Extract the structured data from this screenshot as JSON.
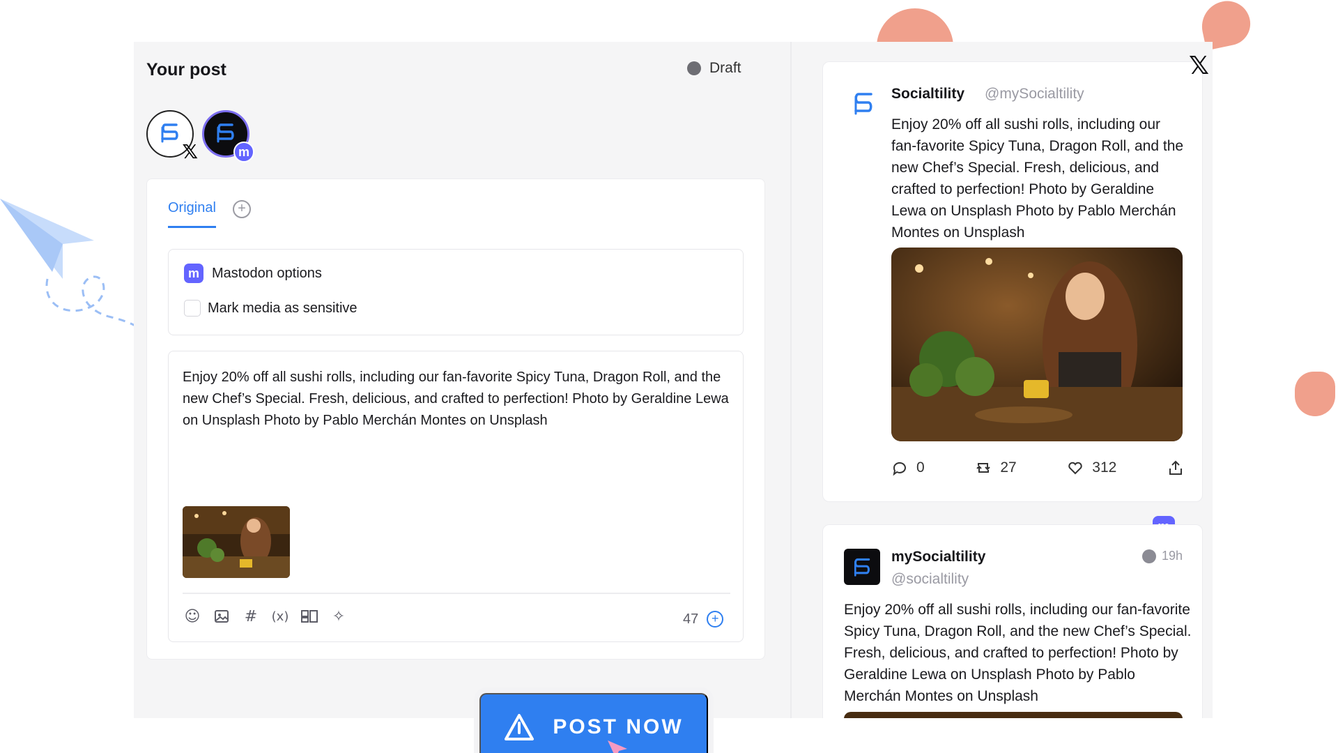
{
  "composer": {
    "title": "Your post",
    "status_label": "Draft",
    "accounts": [
      {
        "network": "x-icon"
      },
      {
        "network": "mastodon-icon"
      }
    ],
    "tabs": {
      "original_label": "Original",
      "add_icon": "plus-circle-icon"
    },
    "mastodon_options": {
      "title": "Mastodon options",
      "sensitive_label": "Mark media as sensitive",
      "sensitive_checked": false
    },
    "post_text": "Enjoy 20% off all sushi rolls, including our fan-favorite Spicy Tuna, Dragon Roll, and the new Chef’s Special. Fresh, delicious, and crafted to perfection! Photo by Geraldine Lewa on Unsplash Photo by Pablo Merchán Montes on Unsplash",
    "toolbar_icons": [
      "emoji-icon",
      "image-icon",
      "hashtag-icon",
      "variable-icon",
      "preview-icon",
      "ai-sparkle-icon"
    ],
    "char_count": "47",
    "post_button_label": "POST NOW"
  },
  "preview": {
    "x": {
      "name": "Socialtility",
      "handle": "@mySocialtility",
      "text": "Enjoy 20% off all sushi rolls, including our fan-favorite Spicy Tuna, Dragon Roll, and the new Chef’s Special. Fresh, delicious, and crafted to perfection! Photo by Geraldine Lewa on Unsplash Photo by Pablo Merchán Montes on Unsplash",
      "replies": "0",
      "reposts": "27",
      "likes": "312"
    },
    "mastodon": {
      "name": "mySocialtility",
      "handle": "@socialtility",
      "time": "19h",
      "text": "Enjoy 20% off all sushi rolls, including our fan-favorite Spicy Tuna, Dragon Roll, and the new Chef’s Special. Fresh, delicious, and crafted to perfection! Photo by Geraldine Lewa on Unsplash Photo by Pablo Merchán Montes on Unsplash"
    }
  },
  "colors": {
    "accent": "#2f7ff0",
    "mastodon": "#6364ff",
    "decor": "#f0a08c"
  }
}
